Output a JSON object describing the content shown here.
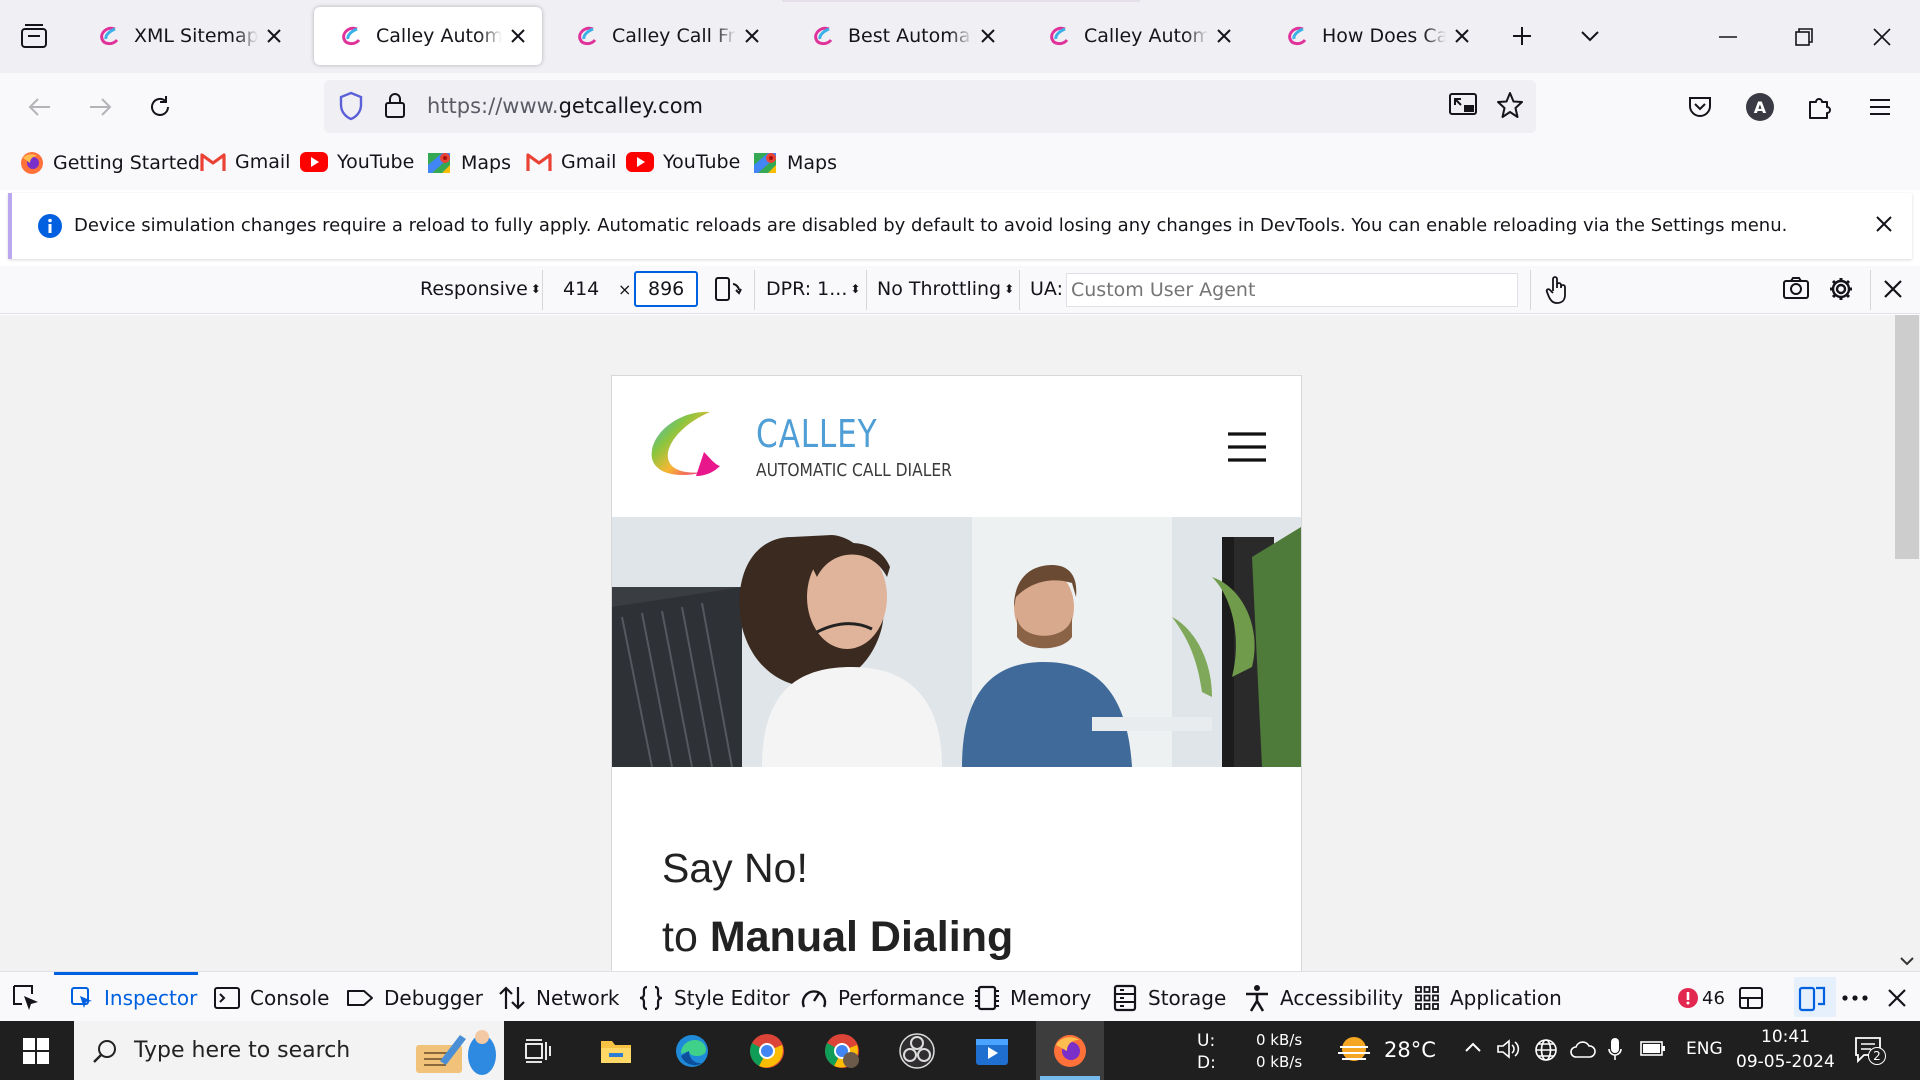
{
  "browser": {
    "tabs": [
      {
        "title": "XML Sitemap - Calley",
        "active": false
      },
      {
        "title": "Calley Automatic Call Dialer",
        "active": true
      },
      {
        "title": "Calley Call From Desktop",
        "active": false
      },
      {
        "title": "Best Automatic Call Dialer",
        "active": false
      },
      {
        "title": "Calley Automatic Dialer",
        "active": false
      },
      {
        "title": "How Does Calley Work",
        "active": false
      }
    ],
    "url_prefix": "https://www.",
    "url_domain": "getcalley.com",
    "bookmarks": [
      {
        "label": "Getting Started",
        "icon": "firefox-icon"
      },
      {
        "label": "Gmail",
        "icon": "gmail-icon"
      },
      {
        "label": "YouTube",
        "icon": "youtube-icon"
      },
      {
        "label": "Maps",
        "icon": "maps-icon"
      },
      {
        "label": "Gmail",
        "icon": "gmail-icon"
      },
      {
        "label": "YouTube",
        "icon": "youtube-icon"
      },
      {
        "label": "Maps",
        "icon": "maps-icon"
      }
    ],
    "account_initial": "A"
  },
  "notification": {
    "text": "Device simulation changes require a reload to fully apply. Automatic reloads are disabled by default to avoid losing any changes in DevTools. You can enable reloading via the Settings menu."
  },
  "rdm": {
    "device": "Responsive",
    "width": "414",
    "times": "×",
    "height": "896",
    "dpr": "DPR: 1...",
    "throttling": "No Throttling",
    "ua_label": "UA:",
    "ua_placeholder": "Custom User Agent"
  },
  "site": {
    "brand": "CALLEY",
    "tagline": "AUTOMATIC CALL DIALER",
    "headline1": "Say No!",
    "headline2_pre": "to ",
    "headline2_bold": "Manual Dialing"
  },
  "devtools": {
    "tabs": [
      "Inspector",
      "Console",
      "Debugger",
      "Network",
      "Style Editor",
      "Performance",
      "Memory",
      "Storage",
      "Accessibility",
      "Application"
    ],
    "error_count": "46"
  },
  "taskbar": {
    "search_placeholder": "Type here to search",
    "net_up_label": "U:",
    "net_down_label": "D:",
    "net_up": "0 kB/s",
    "net_down": "0 kB/s",
    "temperature": "28°C",
    "language": "ENG",
    "time": "10:41",
    "date": "09-05-2024",
    "notif_count": "2"
  },
  "colors": {
    "accent": "#0061e0",
    "brand": "#4f9fd6"
  }
}
